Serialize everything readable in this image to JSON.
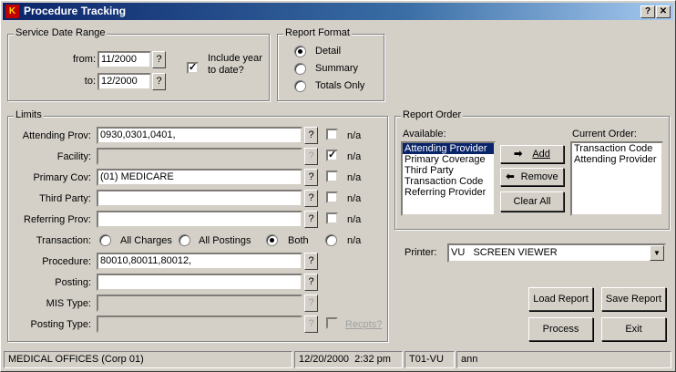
{
  "window": {
    "title": "Procedure Tracking",
    "help_glyph": "?",
    "close_glyph": "✕",
    "app_icon_text": "K"
  },
  "service_date": {
    "group_label": "Service Date Range",
    "from_label": "from:",
    "from_value": "11/2000",
    "to_label": "to:",
    "to_value": "12/2000",
    "lookup_glyph": "?",
    "ytd_label": "Include year to date?",
    "ytd_checked": true
  },
  "report_format": {
    "group_label": "Report Format",
    "options": [
      "Detail",
      "Summary",
      "Totals Only"
    ],
    "selected": "Detail"
  },
  "limits": {
    "group_label": "Limits",
    "na_label": "n/a",
    "lookup_glyph": "?",
    "rows": [
      {
        "label": "Attending Prov:",
        "value": "0930,0301,0401,",
        "na_checked": false
      },
      {
        "label": "Facility:",
        "value": "",
        "na_checked": true,
        "disabled": true
      },
      {
        "label": "Primary Cov:",
        "value": "(01) MEDICARE",
        "na_checked": false
      },
      {
        "label": "Third Party:",
        "value": "",
        "na_checked": false
      },
      {
        "label": "Referring Prov:",
        "value": "",
        "na_checked": false
      }
    ],
    "transaction": {
      "label": "Transaction:",
      "options": [
        "All Charges",
        "All Postings",
        "Both",
        "n/a"
      ],
      "selected": "Both"
    },
    "procedure": {
      "label": "Procedure:",
      "value": "80010,80011,80012,"
    },
    "posting": {
      "label": "Posting:",
      "value": ""
    },
    "mis_type": {
      "label": "MIS Type:",
      "value": ""
    },
    "posting_type": {
      "label": "Posting Type:",
      "value": "",
      "recpts_label": "Recpts?"
    }
  },
  "report_order": {
    "group_label": "Report Order",
    "available_label": "Available:",
    "available": [
      "Attending Provider",
      "Primary Coverage",
      "Third Party",
      "Transaction Code",
      "Referring Provider"
    ],
    "available_selected": "Attending Provider",
    "add_label": "Add",
    "remove_label": "Remove",
    "clear_label": "Clear All",
    "current_label": "Current Order:",
    "current": [
      "Transaction Code",
      "Attending Provider"
    ]
  },
  "printer": {
    "label": "Printer:",
    "value": "VU   SCREEN VIEWER"
  },
  "buttons": {
    "load": "Load Report",
    "save": "Save Report",
    "process": "Process",
    "exit": "Exit"
  },
  "status_bar": {
    "office": "MEDICAL OFFICES (Corp 01)",
    "datetime": "12/20/2000  2:32 pm",
    "terminal": "T01-VU",
    "user": "ann"
  }
}
